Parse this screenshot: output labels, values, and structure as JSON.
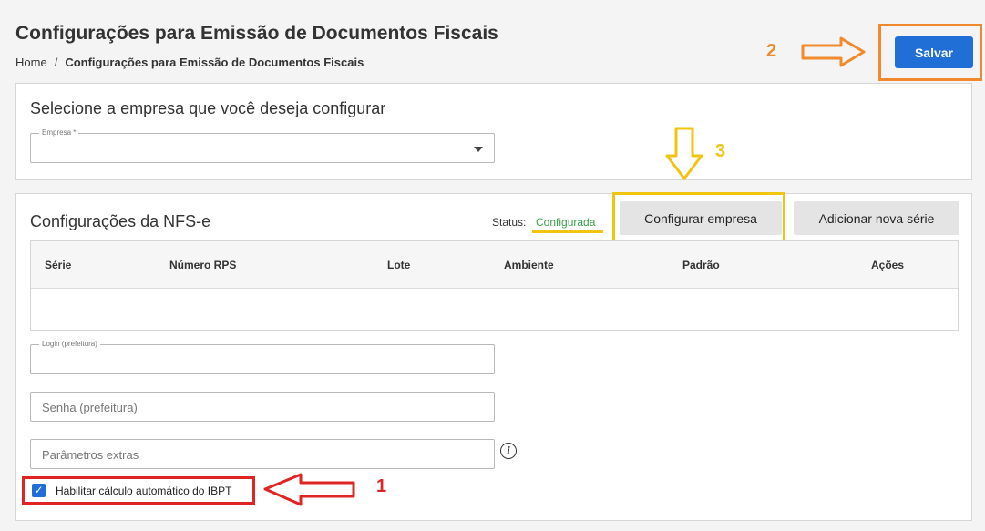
{
  "header": {
    "title": "Configurações para Emissão de Documentos Fiscais",
    "breadcrumb": {
      "home": "Home",
      "separator": "/",
      "current": "Configurações para Emissão de Documentos Fiscais"
    },
    "save_label": "Salvar"
  },
  "company_card": {
    "title": "Selecione a empresa que você deseja configurar",
    "company_field": {
      "label": "Empresa *",
      "value": ""
    }
  },
  "nfse_card": {
    "title": "Configurações da NFS-e",
    "status_label": "Status:",
    "status_value": "Configurada",
    "configure_label": "Configurar empresa",
    "add_series_label": "Adicionar nova série",
    "table": {
      "columns": [
        "Série",
        "Número RPS",
        "Lote",
        "Ambiente",
        "Padrão",
        "Ações"
      ],
      "rows": []
    },
    "login_field": {
      "label": "Login (prefeitura)",
      "value": ""
    },
    "password_field": {
      "placeholder": "Senha (prefeitura)"
    },
    "extra_params_field": {
      "placeholder": "Parâmetros extras"
    },
    "info_icon": "i",
    "ibpt_checkbox": {
      "label": "Habilitar cálculo automático do IBPT",
      "checked": true,
      "check_glyph": "✓"
    }
  },
  "annotations": [
    {
      "number": "1",
      "color": "#e02424"
    },
    {
      "number": "2",
      "color": "#f08a2c"
    },
    {
      "number": "3",
      "color": "#f1c40f"
    }
  ],
  "colors": {
    "primary": "#1f6fd6",
    "status_ok": "#3aa14a"
  }
}
